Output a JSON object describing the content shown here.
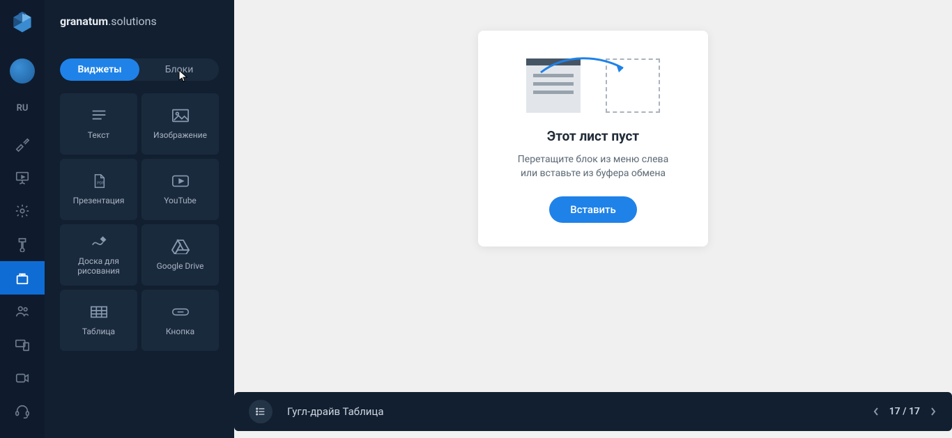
{
  "brand": {
    "bold": "granatum",
    "thin": ".solutions"
  },
  "rail": {
    "lang": "RU"
  },
  "tabs": {
    "widgets": "Виджеты",
    "blocks": "Блоки"
  },
  "widgets": [
    {
      "label": "Текст"
    },
    {
      "label": "Изображение"
    },
    {
      "label": "Презентация"
    },
    {
      "label": "YouTube"
    },
    {
      "label": "Доска для рисования"
    },
    {
      "label": "Google Drive"
    },
    {
      "label": "Таблица"
    },
    {
      "label": "Кнопка"
    }
  ],
  "empty": {
    "title": "Этот лист пуст",
    "line1": "Перетащите блок из меню слева",
    "line2": "или вставьте из буфера обмена",
    "button": "Вставить"
  },
  "bottombar": {
    "title": "Гугл-драйв Таблица",
    "page": "17 / 17"
  }
}
